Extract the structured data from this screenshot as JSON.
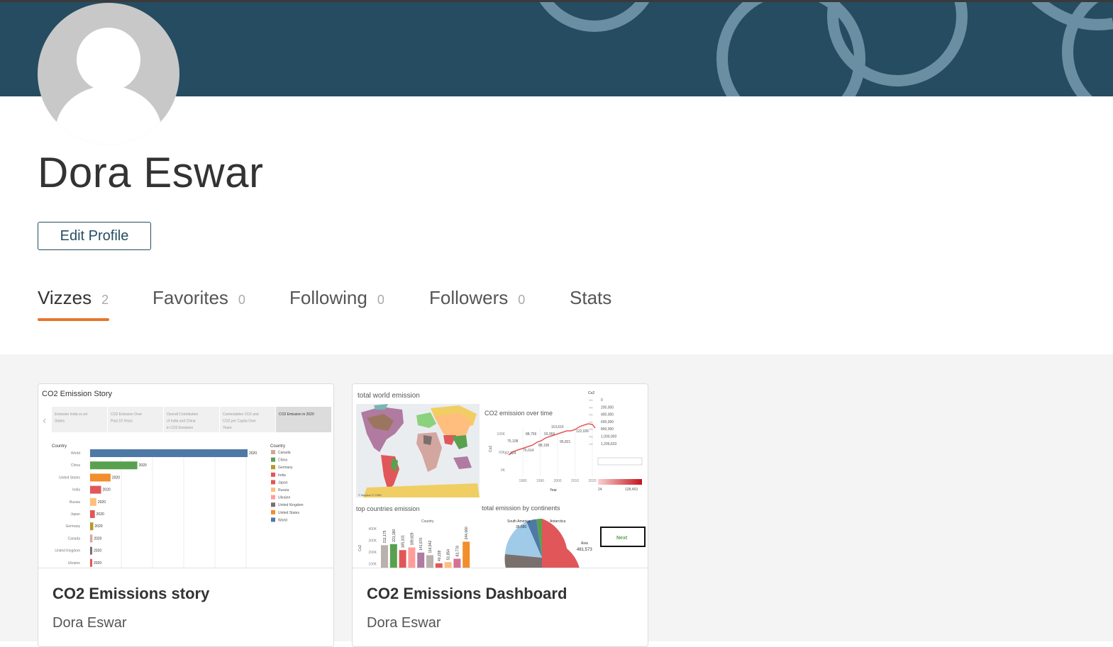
{
  "profile": {
    "name": "Dora Eswar",
    "edit_label": "Edit Profile"
  },
  "tabs": [
    {
      "label": "Vizzes",
      "count": "2"
    },
    {
      "label": "Favorites",
      "count": "0"
    },
    {
      "label": "Following",
      "count": "0"
    },
    {
      "label": "Followers",
      "count": "0"
    },
    {
      "label": "Stats",
      "count": ""
    }
  ],
  "colors": {
    "banner": "#254c61",
    "accent": "#e8762d",
    "ring": "#6b8fa2"
  },
  "cards": [
    {
      "title": "CO2 Emissions story",
      "author": "Dora Eswar",
      "thumb": {
        "story_title": "CO2 Emission Story",
        "story_points": [
          "Emission India vs ed States",
          "CO2 Emission Over Past 10 Years",
          "Overall Contribution of India and China in CO2 Emission",
          "Commulative CO2 and CO2 per Capita Over Years",
          "CO2 Emission in 2020"
        ],
        "column_header": "Country",
        "legend_title": "Country",
        "bars": [
          {
            "country": "World",
            "value": 100,
            "color": "#4e79a7"
          },
          {
            "country": "China",
            "value": 30,
            "color": "#59a14f"
          },
          {
            "country": "United States",
            "value": 13,
            "color": "#f28e2b"
          },
          {
            "country": "India",
            "value": 7,
            "color": "#e15759"
          },
          {
            "country": "Russia",
            "value": 4,
            "color": "#ffbe7d"
          },
          {
            "country": "Japan",
            "value": 3,
            "color": "#e15759"
          },
          {
            "country": "Germany",
            "value": 2,
            "color": "#b6992d"
          },
          {
            "country": "Canada",
            "value": 1.5,
            "color": "#d4a6a0"
          },
          {
            "country": "United Kingdom",
            "value": 1.2,
            "color": "#79706e"
          },
          {
            "country": "Ukraine",
            "value": 1,
            "color": "#e15759"
          }
        ],
        "bar_label": "2020",
        "legend": [
          {
            "label": "Canada",
            "color": "#d4a6a0"
          },
          {
            "label": "China",
            "color": "#59a14f"
          },
          {
            "label": "Germany",
            "color": "#b6992d"
          },
          {
            "label": "India",
            "color": "#e15759"
          },
          {
            "label": "Japan",
            "color": "#e15759"
          },
          {
            "label": "Russia",
            "color": "#ffbe7d"
          },
          {
            "label": "Ukraine",
            "color": "#ff9d9a"
          },
          {
            "label": "United Kingdom",
            "color": "#79706e"
          },
          {
            "label": "United States",
            "color": "#f28e2b"
          },
          {
            "label": "World",
            "color": "#4e79a7"
          }
        ]
      }
    },
    {
      "title": "CO2 Emissions Dashboard",
      "author": "Dora Eswar",
      "thumb": {
        "map_title": "total world emission",
        "map_credit": "© Mapbox © OSM",
        "line_title": "CO2 emission over time",
        "line_ylabel": "Co2",
        "line_xlabel": "Year",
        "line_yticks": [
          "100K",
          "50K",
          "0K"
        ],
        "line_xticks": [
          "1980",
          "1990",
          "2000",
          "2010",
          "2020"
        ],
        "line_labels": [
          "75,108",
          "67,324",
          "75,014",
          "88,759",
          "93,959",
          "88,195",
          "110,616",
          "95,821",
          "122,026"
        ],
        "legend_title": "Co2",
        "legend_values": [
          "0",
          "200,000",
          "400,000",
          "600,000",
          "800,000",
          "1,000,000",
          "1,206,633"
        ],
        "gradient_min": "24",
        "gradient_max": "128,453",
        "bar_title": "top countries emission",
        "bar_header": "Country",
        "bar_ylabel": "Co2",
        "bar_yticks": [
          "400K",
          "300K",
          "200K",
          "100K"
        ],
        "bar_values": [
          "211,175",
          "221,180",
          "165,101",
          "189,829",
          "141,670",
          "116,942",
          "40,228",
          "51,854",
          "83,778",
          "244,060"
        ],
        "pie_title": "total emission by continents",
        "pie_labels": [
          "South America",
          "35,680",
          "Antarctica",
          "Asia",
          "481,573"
        ],
        "next_label": "Next"
      }
    }
  ]
}
